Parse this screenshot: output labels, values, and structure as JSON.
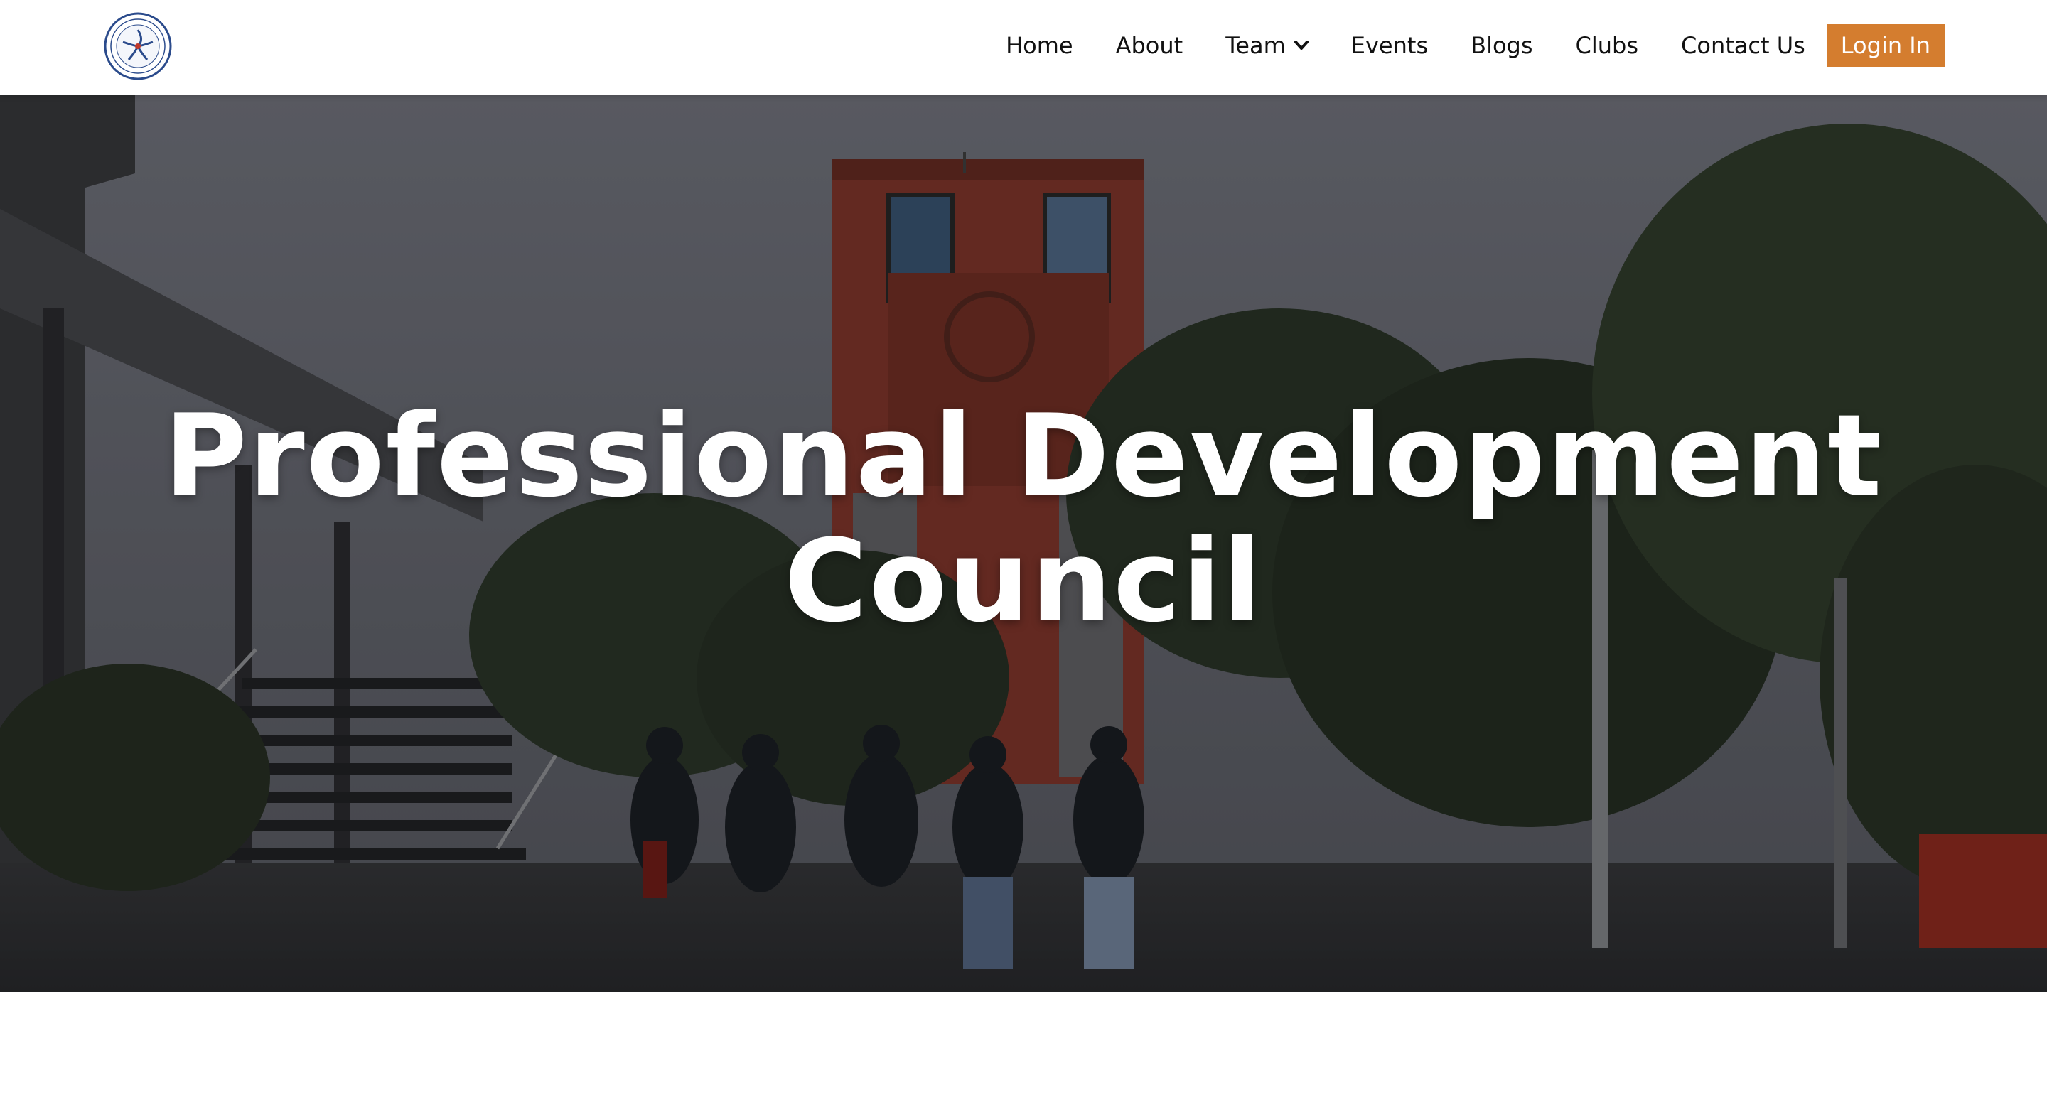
{
  "logo": {
    "icon": "institute-emblem-icon"
  },
  "nav": {
    "items": [
      {
        "label": "Home"
      },
      {
        "label": "About"
      },
      {
        "label": "Team",
        "dropdown": true
      },
      {
        "label": "Events"
      },
      {
        "label": "Blogs"
      },
      {
        "label": "Clubs"
      },
      {
        "label": "Contact Us"
      }
    ],
    "login_label": "Login In"
  },
  "hero": {
    "title_line1": "Professional Development",
    "title_line2": "Council"
  },
  "colors": {
    "accent": "#d47d2f",
    "nav_text": "#111111",
    "tower_brick": "#8a3a2e"
  }
}
